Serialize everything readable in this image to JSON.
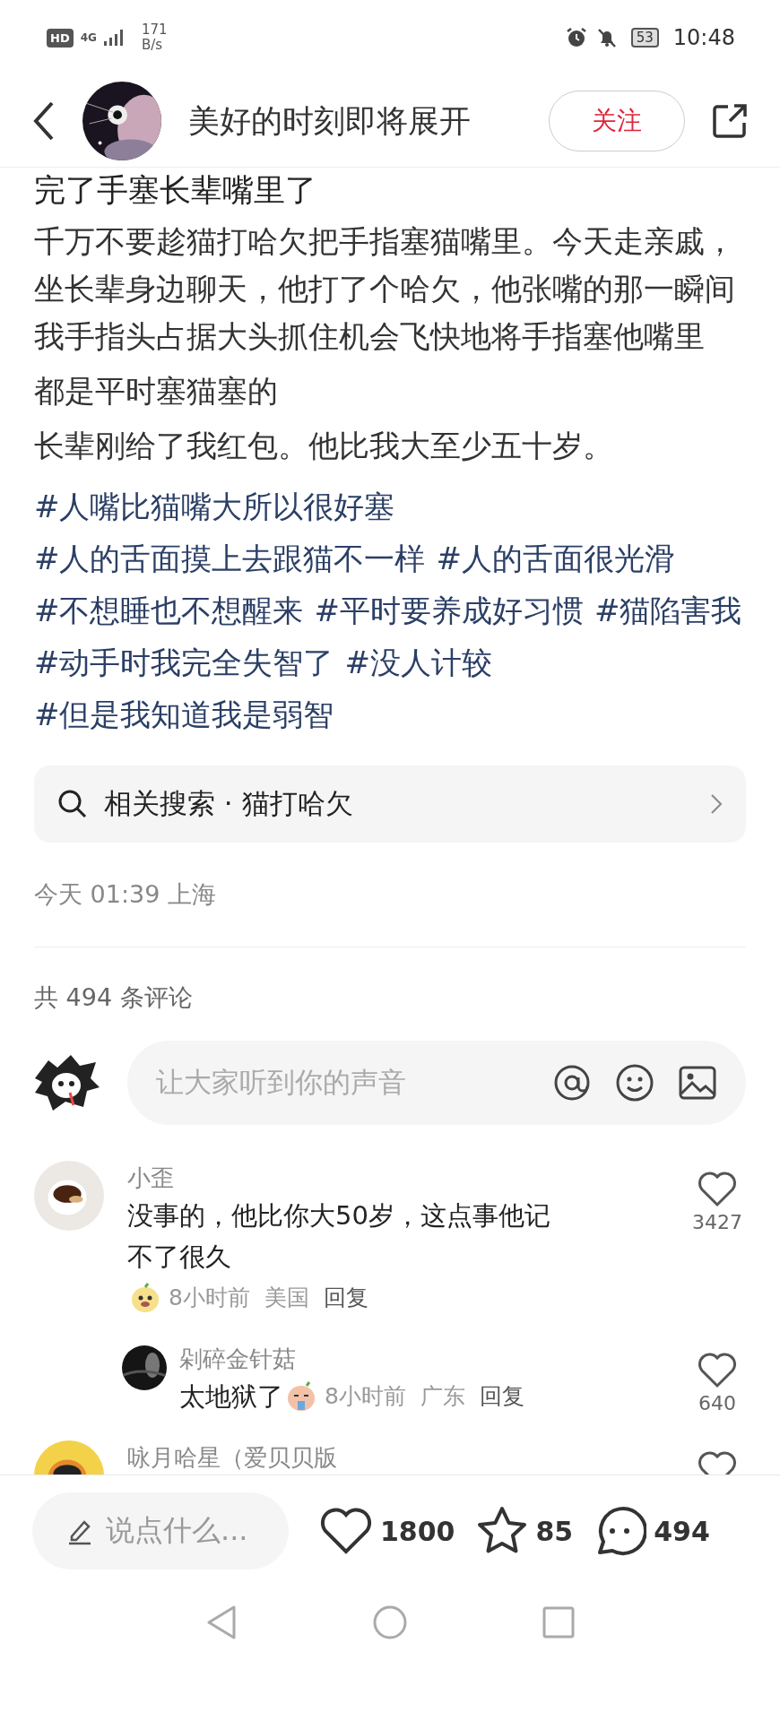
{
  "status_bar": {
    "hd_badge": "HD",
    "network": "4G",
    "speed_value": "171",
    "speed_unit": "B/s",
    "battery": "53",
    "time": "10:48"
  },
  "header": {
    "author": "美好的时刻即将展开",
    "follow_button": "关注"
  },
  "post": {
    "title": "完了手塞长辈嘴里了",
    "paragraphs": [
      "千万不要趁猫打哈欠把手指塞猫嘴里。今天走亲戚，坐长辈身边聊天，他打了个哈欠，他张嘴的那一瞬间我手指头占据大头抓住机会飞快地将手指塞他嘴里",
      "都是平时塞猫塞的",
      "长辈刚给了我红包。他比我大至少五十岁。"
    ],
    "tags": [
      "#人嘴比猫嘴大所以很好塞",
      "#人的舌面摸上去跟猫不一样",
      "#人的舌面很光滑",
      "#不想睡也不想醒来",
      "#平时要养成好习惯",
      "#猫陷害我",
      "#动手时我完全失智了",
      "#没人计较",
      "#但是我知道我是弱智"
    ],
    "related_search": "相关搜索 · 猫打哈欠",
    "meta": "今天 01:39 上海"
  },
  "comments_header": "共 494 条评论",
  "comment_input": {
    "placeholder": "让大家听到你的声音"
  },
  "comments": [
    {
      "user": "小歪",
      "text": "没事的，他比你大50岁，这点事他记不了很久",
      "time": "8小时前",
      "location": "美国",
      "reply": "回复",
      "likes": "3427",
      "liked": false,
      "children": [
        {
          "user": "剁碎金针菇",
          "text": "太地狱了",
          "time": "8小时前",
          "location": "广东",
          "reply": "回复",
          "likes": "640",
          "liked": false
        }
      ]
    },
    {
      "user": "咏月哈星（爱贝贝版",
      "liked": false
    }
  ],
  "bottom_bar": {
    "placeholder": "说点什么...",
    "likes": "1800",
    "stars": "85",
    "comments": "494"
  }
}
